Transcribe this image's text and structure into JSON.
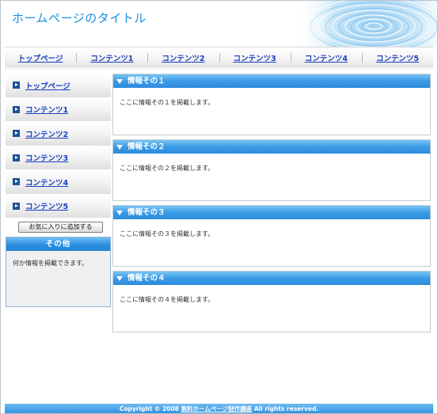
{
  "header": {
    "site_title": "ホームページのタイトル"
  },
  "top_nav": [
    {
      "label": "トップページ"
    },
    {
      "label": "コンテンツ1"
    },
    {
      "label": "コンテンツ2"
    },
    {
      "label": "コンテンツ3"
    },
    {
      "label": "コンテンツ4"
    },
    {
      "label": "コンテンツ5"
    }
  ],
  "side_menu": [
    {
      "label": "トップページ"
    },
    {
      "label": "コンテンツ1"
    },
    {
      "label": "コンテンツ2"
    },
    {
      "label": "コンテンツ3"
    },
    {
      "label": "コンテンツ4"
    },
    {
      "label": "コンテンツ5"
    }
  ],
  "favorite_button": "お気に入りに追加する",
  "other_box": {
    "title": "その他",
    "text": "何か情報を掲載できます。"
  },
  "sections": [
    {
      "title": "情報その１",
      "body": "ここに情報その１を掲載します。"
    },
    {
      "title": "情報その２",
      "body": "ここに情報その２を掲載します。"
    },
    {
      "title": "情報その３",
      "body": "ここに情報その３を掲載します。"
    },
    {
      "title": "情報その４",
      "body": "ここに情報その４を掲載します。"
    }
  ],
  "footer": {
    "prefix": "Copyright © 2008 ",
    "link": "無料ホームページ制作講座",
    "suffix": " All rights reserved."
  },
  "colors": {
    "accent": "#2b8bdc",
    "link": "#1a3fbf",
    "title": "#1a8fe0"
  }
}
